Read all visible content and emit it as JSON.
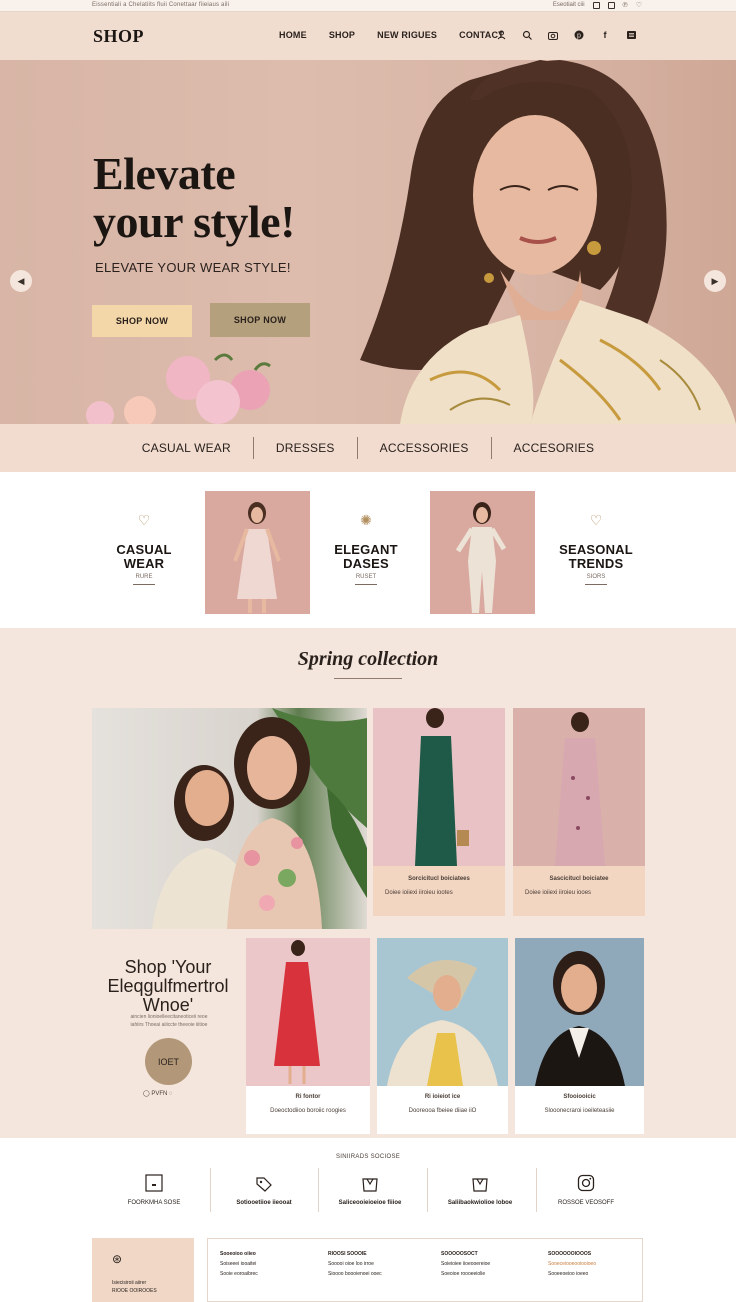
{
  "topbar": {
    "left_text": "Eissentiali a Chelatiits fluii Conettaar fiieiaus aili",
    "right_text": "Eseotiait ciii"
  },
  "header": {
    "logo": "SHOP",
    "nav": [
      "HOME",
      "SHOP",
      "NEW RIGUES",
      "CONTACT"
    ],
    "icons": [
      "user-icon",
      "search-icon",
      "camera-icon",
      "pinterest-icon",
      "facebook-icon",
      "menu-icon"
    ]
  },
  "hero": {
    "headline_line1": "Elevate",
    "headline_line2": "your style!",
    "subheadline": "ELEVATE YOUR WEAR STYLE!",
    "button_primary": "SHOP NOW",
    "button_secondary": "SHOP NOW"
  },
  "category_bar": [
    "CASUAL WEAR",
    "DRESSES",
    "ACCESSORIES",
    "ACCESORIES"
  ],
  "features": [
    {
      "title_line1": "CASUAL",
      "title_line2": "WEAR",
      "sub": "RURE"
    },
    {
      "title_line1": "ELEGANT",
      "title_line2": "DASES",
      "sub": "RUSET"
    },
    {
      "title_line1": "SEASONAL",
      "title_line2": "TRENDS",
      "sub": "SIORS"
    }
  ],
  "spring": {
    "title": "Spring collection",
    "products_top": [
      {
        "name": "Sorcicitucl boiciatees",
        "price": "Doiee ioiiexi iiroieu iootes"
      },
      {
        "name": "Sascicitucl boiciatee",
        "price": "Doiee ioiiexi iiroieu iooes"
      }
    ],
    "promo": {
      "heading_line1": "Shop 'Your",
      "heading_line2": "Eleqgulfmertrol",
      "heading_line3": "Wnoe'",
      "subtext_line1": "aincien lionioelleecitaneoticeii reoe",
      "subtext_line2": "iahiirs Thoeai aiiiccte theeoie iiitioe",
      "button": "IOET",
      "dots": "◯ PVFN  ◌"
    },
    "products_bottom": [
      {
        "name": "Ri fontor",
        "desc": "Doeoctodiioo boroiic roogies"
      },
      {
        "name": "Ri ioieiot ice",
        "desc": "Dooreooa fbeiee diiae iiO"
      },
      {
        "name": "Sfooiooicic",
        "desc": "Slooonecraroi ioeileteasiie"
      }
    ]
  },
  "services": {
    "heading": "SINIIRADS SOCIOSE",
    "items": [
      {
        "icon": "monitor-icon",
        "label": "FOORKMHA SOSE"
      },
      {
        "icon": "tag-icon",
        "label": "Sotiooetiioe iieooat"
      },
      {
        "icon": "bag-icon",
        "label": "Saliceooieioeioe fiiioe"
      },
      {
        "icon": "bag-icon",
        "label": "Saliibaokwiolioe loboe"
      },
      {
        "icon": "instagram-icon",
        "label": "ROSSOE VEOSOFF"
      }
    ]
  },
  "footer": {
    "box_line1": "Isiecisiroii aiirer",
    "box_line2": "RIOOE OOIROOES",
    "columns": [
      {
        "head": "Sooeoioo oiieo",
        "l1": "Soiseeei iooaitei",
        "l2": "Sooie eoroaibrec"
      },
      {
        "head": "RIOOSI SOOOIE",
        "l1": "Sooooi oioe loo irroe",
        "l2": "Sioooo boooienoei ooec"
      },
      {
        "head": "SOOOOOSOCT",
        "l1": "Soieioiee iioeooereioe",
        "l2": "Soeoioe roooeeiolie"
      },
      {
        "head": "SOOOOOOIOOOS",
        "l1": "Sooeceiooeooiooioeo",
        "l2": "Sooeeoeioo ioeeo"
      }
    ]
  }
}
